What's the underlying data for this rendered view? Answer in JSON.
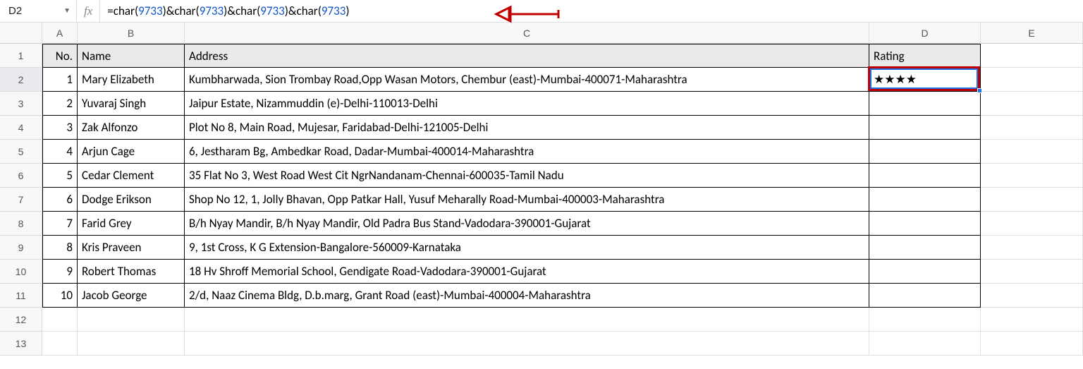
{
  "nameBox": "D2",
  "formula": {
    "segments": [
      {
        "t": "=",
        "c": "fn"
      },
      {
        "t": "char",
        "c": "fn"
      },
      {
        "t": "(",
        "c": "paren"
      },
      {
        "t": "9733",
        "c": "num"
      },
      {
        "t": ")",
        "c": "paren"
      },
      {
        "t": "&",
        "c": "amp"
      },
      {
        "t": "char",
        "c": "fn"
      },
      {
        "t": "(",
        "c": "paren"
      },
      {
        "t": "9733",
        "c": "num"
      },
      {
        "t": ")",
        "c": "paren"
      },
      {
        "t": "&",
        "c": "amp"
      },
      {
        "t": "char",
        "c": "fn"
      },
      {
        "t": "(",
        "c": "paren"
      },
      {
        "t": "9733",
        "c": "num"
      },
      {
        "t": ")",
        "c": "paren"
      },
      {
        "t": "&",
        "c": "amp"
      },
      {
        "t": "char",
        "c": "fn"
      },
      {
        "t": "(",
        "c": "paren"
      },
      {
        "t": "9733",
        "c": "num"
      },
      {
        "t": ")",
        "c": "paren"
      }
    ]
  },
  "columns": [
    "A",
    "B",
    "C",
    "D",
    "E"
  ],
  "rowNumbers": [
    1,
    2,
    3,
    4,
    5,
    6,
    7,
    8,
    9,
    10,
    11,
    12,
    13
  ],
  "headers": {
    "A": "No.",
    "B": "Name",
    "C": "Address",
    "D": "Rating"
  },
  "data": [
    {
      "no": 1,
      "name": "Mary Elizabeth",
      "address": "Kumbharwada, Sion Trombay Road,Opp Wasan Motors, Chembur (east)-Mumbai-400071-Maharashtra",
      "rating": "★★★★"
    },
    {
      "no": 2,
      "name": "Yuvaraj Singh",
      "address": "Jaipur Estate, Nizammuddin (e)-Delhi-110013-Delhi",
      "rating": ""
    },
    {
      "no": 3,
      "name": "Zak Alfonzo",
      "address": "Plot No 8, Main Road, Mujesar, Faridabad-Delhi-121005-Delhi",
      "rating": ""
    },
    {
      "no": 4,
      "name": "Arjun Cage",
      "address": "6, Jestharam Bg, Ambedkar Road, Dadar-Mumbai-400014-Maharashtra",
      "rating": ""
    },
    {
      "no": 5,
      "name": "Cedar Clement",
      "address": "35 Flat No 3, West Road West Cit NgrNandanam-Chennai-600035-Tamil Nadu",
      "rating": ""
    },
    {
      "no": 6,
      "name": "Dodge Erikson",
      "address": "Shop No 12, 1, Jolly Bhavan, Opp Patkar Hall, Yusuf Meharally Road-Mumbai-400003-Maharashtra",
      "rating": ""
    },
    {
      "no": 7,
      "name": "Farid Grey",
      "address": "B/h Nyay Mandir, B/h Nyay Mandir, Old Padra Bus Stand-Vadodara-390001-Gujarat",
      "rating": ""
    },
    {
      "no": 8,
      "name": "Kris Praveen",
      "address": "9, 1st Cross, K G Extension-Bangalore-560009-Karnataka",
      "rating": ""
    },
    {
      "no": 9,
      "name": "Robert Thomas",
      "address": "18 Hv Shroff Memorial School, Gendigate Road-Vadodara-390001-Gujarat",
      "rating": ""
    },
    {
      "no": 10,
      "name": "Jacob George",
      "address": "2/d, Naaz Cinema Bldg, D.b.marg, Grant Road (east)-Mumbai-400004-Maharashtra",
      "rating": ""
    }
  ],
  "activeCell": "D2",
  "annotation": {
    "arrowColor": "#c00000",
    "highlightColor": "#c00000"
  }
}
